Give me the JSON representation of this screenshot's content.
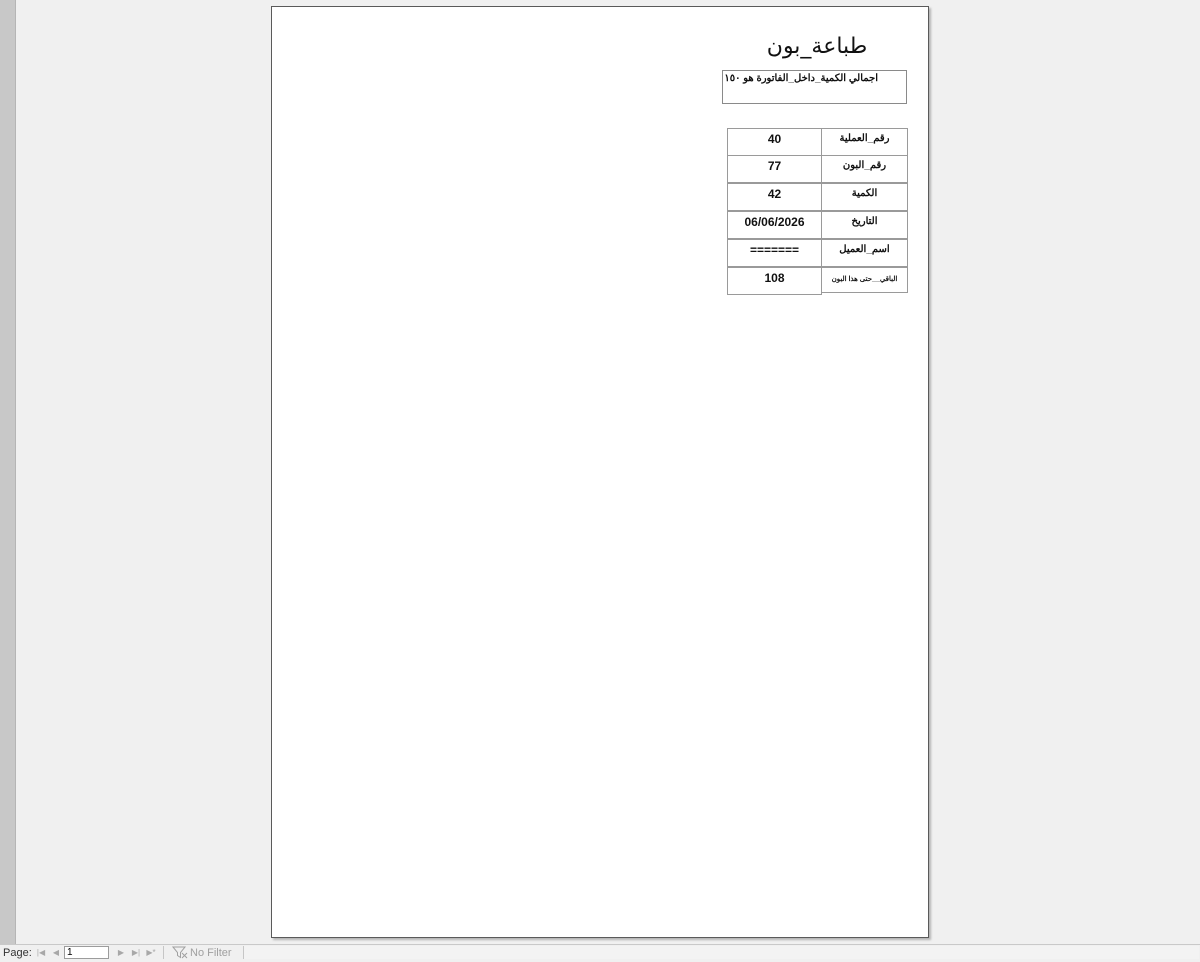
{
  "report": {
    "title": "طباعة_بون",
    "total_line": "اجمالي الكمية_داخل_الفاتورة هو ١٥٠",
    "rows": [
      {
        "label": "رقم_العملية",
        "value": "40"
      },
      {
        "label": "رقم_البون",
        "value": "77"
      },
      {
        "label": "الكمية",
        "value": "42"
      },
      {
        "label": "التاريخ",
        "value": "06/06/2026"
      },
      {
        "label": "اسم_العميل",
        "value": "======="
      },
      {
        "label": "الباقي__حتى هذا البون",
        "value": "108"
      }
    ]
  },
  "statusbar": {
    "page_label": "Page:",
    "page_value": "1",
    "filter_label": "No Filter",
    "icons": [
      "first-record-icon",
      "previous-record-icon",
      "next-record-icon",
      "last-record-icon",
      "new-record-icon",
      "filter-icon"
    ]
  }
}
